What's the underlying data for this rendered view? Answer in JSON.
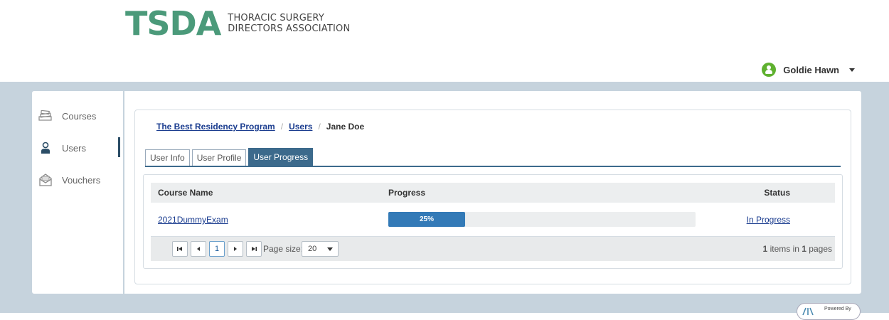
{
  "brand": {
    "logo_text": "TSDA",
    "logo_subtitle_line1": "THORACIC SURGERY",
    "logo_subtitle_line2": "DIRECTORS ASSOCIATION",
    "color": "#4b9a7a"
  },
  "user": {
    "name": "Goldie Hawn"
  },
  "sidebar": {
    "items": [
      {
        "label": "Courses",
        "icon": "books-icon"
      },
      {
        "label": "Users",
        "icon": "user-icon",
        "active": true
      },
      {
        "label": "Vouchers",
        "icon": "voucher-envelope-icon"
      }
    ]
  },
  "breadcrumb": {
    "program": "The Best Residency Program",
    "users": "Users",
    "current": "Jane Doe",
    "separator": "/"
  },
  "tabs": [
    {
      "label": "User Info",
      "active": false
    },
    {
      "label": "User Profile",
      "active": false
    },
    {
      "label": "User Progress",
      "active": true
    }
  ],
  "grid": {
    "columns": [
      "Course Name",
      "Progress",
      "Status"
    ],
    "rows": [
      {
        "course": "2021DummyExam",
        "progress_percent": 25,
        "progress_label": "25%",
        "status": "In Progress"
      }
    ]
  },
  "pager": {
    "current_page": "1",
    "page_size_label": "Page size:",
    "page_size": "20",
    "info_count": "1",
    "info_mid": "items in",
    "info_pages": "1",
    "info_end": "pages"
  },
  "footer": {
    "powered_by": "Powered By"
  },
  "colors": {
    "accent": "#3c6a8c",
    "link": "#1a3c8f",
    "progress": "#337ab7",
    "band": "#c6d3dd"
  }
}
